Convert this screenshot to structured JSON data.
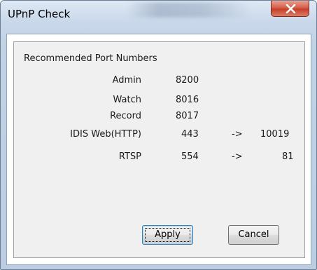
{
  "window": {
    "title": "UPnP Check",
    "close_icon": "close-x-icon",
    "close_color": "#c7402b"
  },
  "section": {
    "title": "Recommended Port Numbers"
  },
  "ports": [
    {
      "label": "Admin",
      "port": "8200",
      "arrow": "",
      "mapped": ""
    },
    {
      "label": "Watch",
      "port": "8016",
      "arrow": "",
      "mapped": ""
    },
    {
      "label": "Record",
      "port": "8017",
      "arrow": "",
      "mapped": ""
    },
    {
      "label": "IDIS Web(HTTP)",
      "port": "443",
      "arrow": "->",
      "mapped": "10019"
    },
    {
      "label": "RTSP",
      "port": "554",
      "arrow": "->",
      "mapped": "81"
    }
  ],
  "buttons": {
    "apply": "Apply",
    "cancel": "Cancel"
  }
}
